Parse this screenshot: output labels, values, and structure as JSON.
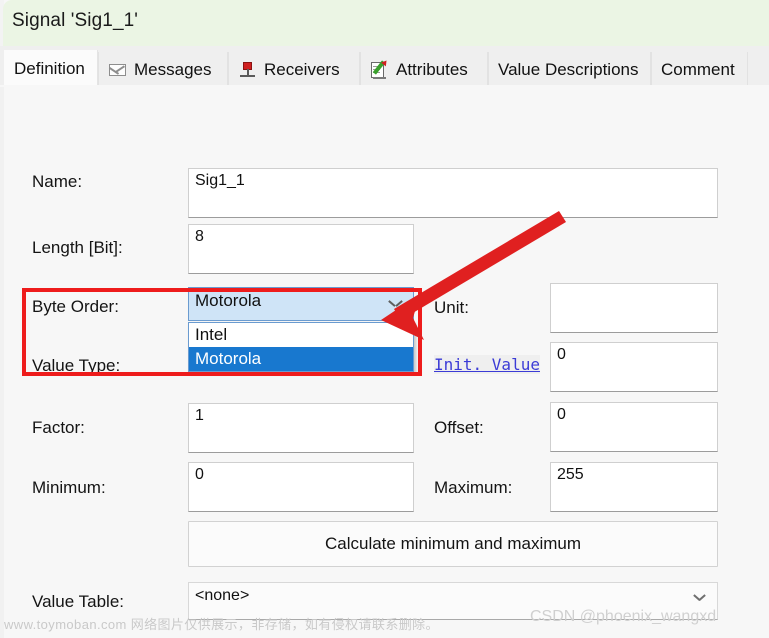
{
  "window": {
    "title": "Signal 'Sig1_1'"
  },
  "tabs": [
    {
      "label": "Definition",
      "icon": "none",
      "active": true
    },
    {
      "label": "Messages",
      "icon": "envelope-icon",
      "active": false
    },
    {
      "label": "Receivers",
      "icon": "pin-icon",
      "active": false
    },
    {
      "label": "Attributes",
      "icon": "attributes-icon",
      "active": false
    },
    {
      "label": "Value Descriptions",
      "icon": "none",
      "active": false
    },
    {
      "label": "Comment",
      "icon": "none",
      "active": false
    }
  ],
  "form": {
    "name_label": "Name:",
    "name_value": "Sig1_1",
    "length_label": "Length [Bit]:",
    "length_value": "8",
    "byte_order_label": "Byte Order:",
    "byte_order_value": "Motorola",
    "byte_order_options": [
      "Intel",
      "Motorola"
    ],
    "byte_order_selected_option": "Motorola",
    "value_type_label": "Value Type:",
    "unit_label": "Unit:",
    "unit_value": "",
    "init_value_label": "Init. Value",
    "init_value": "0",
    "factor_label": "Factor:",
    "factor_value": "1",
    "offset_label": "Offset:",
    "offset_value": "0",
    "minimum_label": "Minimum:",
    "minimum_value": "0",
    "maximum_label": "Maximum:",
    "maximum_value": "255",
    "calculate_button": "Calculate minimum and maximum",
    "value_table_label": "Value Table:",
    "value_table_value": "<none>"
  },
  "annotation": {
    "highlight_color": "#ee1c1c",
    "arrow_color": "#e02020"
  },
  "watermarks": {
    "left": "www.toymoban.com 网络图片仅供展示，非存储，如有侵权请联系删除。",
    "right": "CSDN @phoenix_wangxd"
  }
}
